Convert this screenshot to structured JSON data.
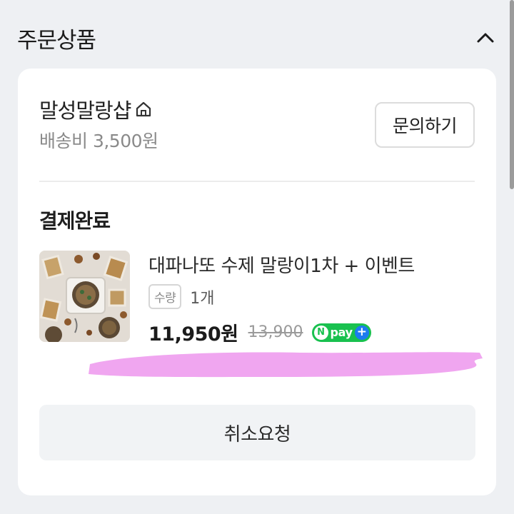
{
  "section": {
    "title": "주문상품"
  },
  "seller": {
    "name": "말성말랑샵",
    "shipping": "배송비 3,500원",
    "inquiry_label": "문의하기"
  },
  "order": {
    "status": "결제완료",
    "product": {
      "name": "대파나또 수제 말랑이1차 + 이벤트",
      "qty_label": "수량",
      "qty_value": "1개",
      "price": "11,950원",
      "original_price": "13,900",
      "badge": {
        "n": "N",
        "text": "pay",
        "plus": "+"
      }
    }
  },
  "actions": {
    "cancel_label": "취소요청"
  },
  "colors": {
    "background": "#eef0f3",
    "card": "#ffffff",
    "npay_green": "#19c14f",
    "npay_blue": "#1d7bf0",
    "redaction_pink": "#f0a6f0"
  },
  "icons": {
    "collapse": "chevron-up-icon",
    "store": "home-icon"
  }
}
